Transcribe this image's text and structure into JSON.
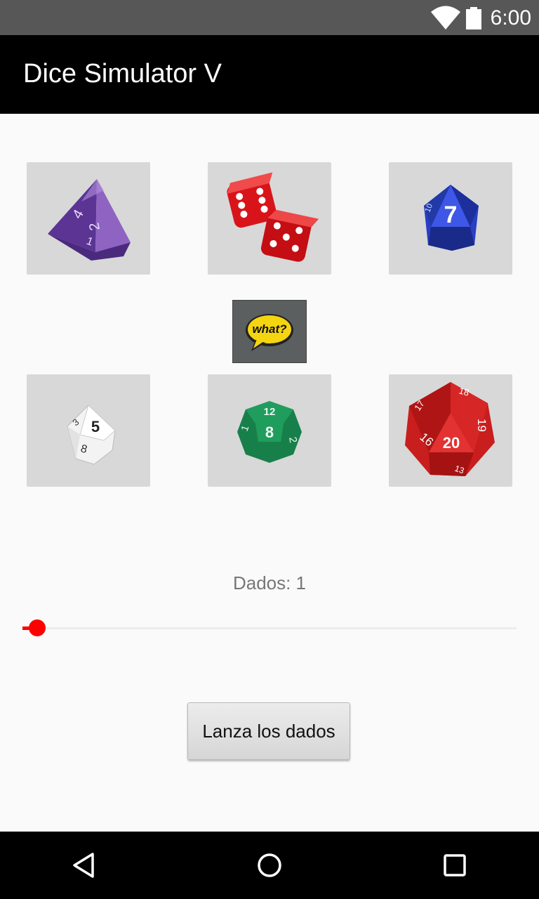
{
  "status_bar": {
    "time": "6:00",
    "icons": [
      "wifi-icon",
      "battery-icon"
    ]
  },
  "app_bar": {
    "title": "Dice Simulator V"
  },
  "dice": [
    {
      "name": "d4",
      "icon": "d4-die-icon",
      "color": "#6a3fa0",
      "face_values": [
        "4",
        "2",
        "1"
      ]
    },
    {
      "name": "d6",
      "icon": "d6-die-icon",
      "color": "#d8141a"
    },
    {
      "name": "d8",
      "icon": "d8-die-icon",
      "color": "#2a3fc4",
      "face_values": [
        "7",
        "10"
      ]
    },
    {
      "name": "d10",
      "icon": "d10-die-icon",
      "color": "#ffffff",
      "face_values": [
        "5",
        "8",
        "3"
      ]
    },
    {
      "name": "d12",
      "icon": "d12-die-icon",
      "color": "#17804a",
      "face_values": [
        "12",
        "8",
        "2",
        "1"
      ]
    },
    {
      "name": "d20",
      "icon": "d20-die-icon",
      "color": "#c81e1e",
      "face_values": [
        "20",
        "16",
        "19",
        "17",
        "18",
        "13"
      ]
    }
  ],
  "help_button": {
    "icon": "what-speech-bubble-icon",
    "text": "what?",
    "color": "#f5d50f"
  },
  "dice_count": {
    "label": "Dados: 1",
    "value": 1,
    "slider_fraction": 0.03,
    "accent": "#ff0000"
  },
  "roll_button": {
    "label": "Lanza los dados"
  },
  "nav_bar": {
    "icons": [
      "back-icon",
      "home-icon",
      "recents-icon"
    ]
  }
}
